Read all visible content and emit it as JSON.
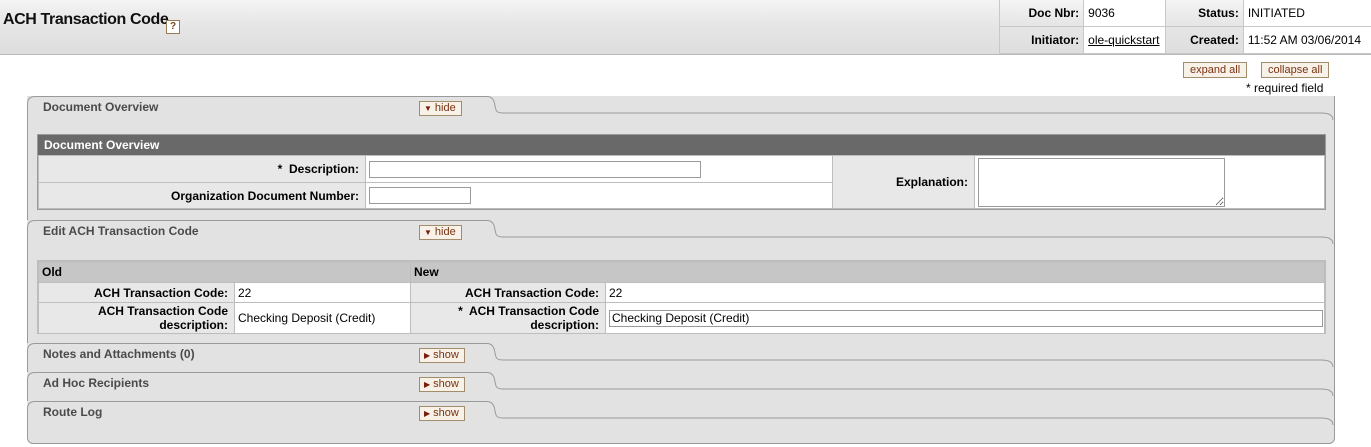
{
  "header": {
    "title": "ACH Transaction Code",
    "help_icon": "?",
    "doc_nbr_label": "Doc Nbr:",
    "doc_nbr": "9036",
    "status_label": "Status:",
    "status": "INITIATED",
    "initiator_label": "Initiator:",
    "initiator": "ole-quickstart",
    "created_label": "Created:",
    "created": "11:52 AM 03/06/2014"
  },
  "controls": {
    "expand_all": "expand all",
    "collapse_all": "collapse all",
    "required_note": "* required field"
  },
  "sections": {
    "doc_overview": {
      "tab_label": "Document Overview",
      "toggle": "hide",
      "panel_title": "Document Overview",
      "description_label": "Description:",
      "required_marker": "*",
      "org_doc_label": "Organization Document Number:",
      "explanation_label": "Explanation:"
    },
    "edit_ach": {
      "tab_label": "Edit ACH Transaction Code",
      "toggle": "hide",
      "old_header": "Old",
      "new_header": "New",
      "code_label": "ACH Transaction Code:",
      "old_code": "22",
      "new_code": "22",
      "desc_label_old": "ACH Transaction Code description:",
      "old_desc": "Checking Deposit (Credit)",
      "required_marker": "*",
      "desc_label_new": "ACH Transaction Code description:",
      "new_desc": "Checking Deposit (Credit)"
    },
    "notes": {
      "tab_label": "Notes and Attachments (0)",
      "toggle": "show"
    },
    "adhoc": {
      "tab_label": "Ad Hoc Recipients",
      "toggle": "show"
    },
    "route_log": {
      "tab_label": "Route Log",
      "toggle": "show"
    }
  },
  "colors": {
    "panel_header": "#696969",
    "label_bg": "#e8e8e8",
    "button_text": "#7a3212"
  }
}
